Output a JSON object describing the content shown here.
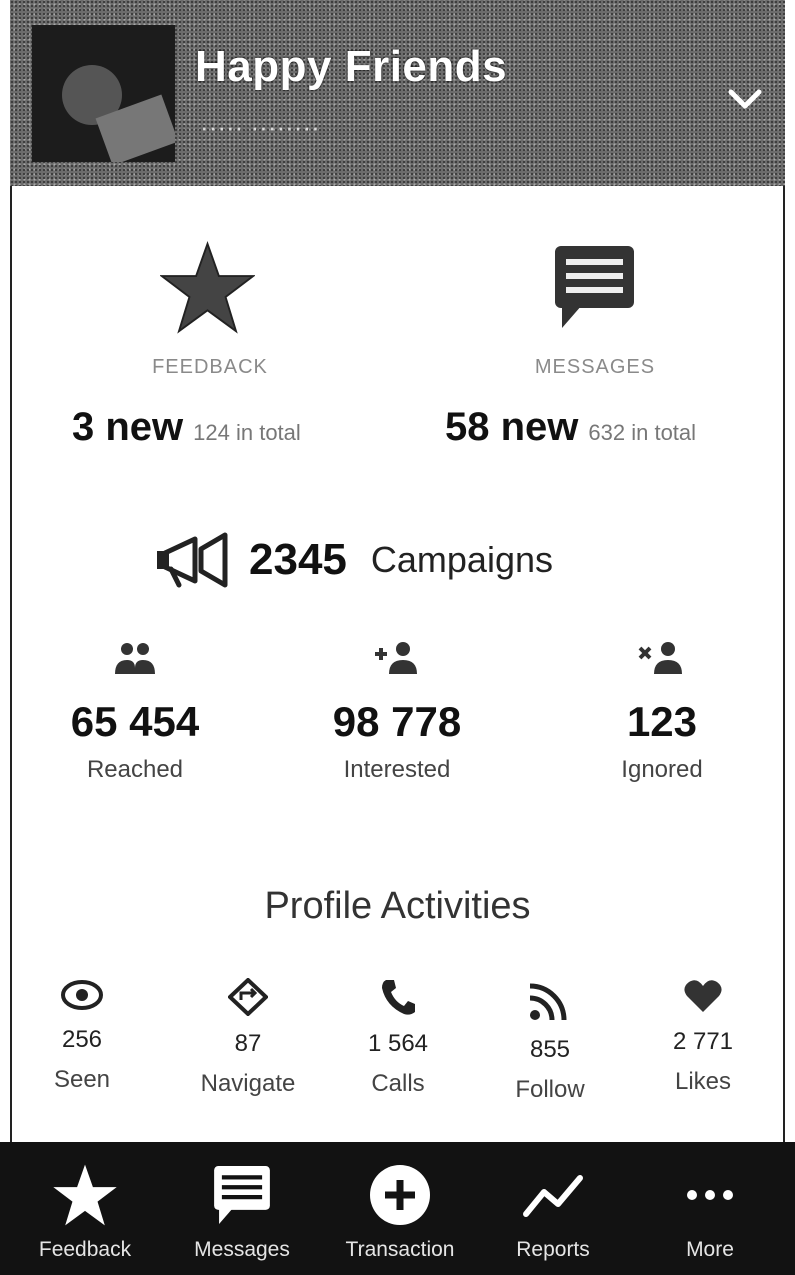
{
  "header": {
    "title": "Happy Friends",
    "subtitle": "·····  ········"
  },
  "stats": {
    "feedback": {
      "label": "FEEDBACK",
      "new": "3 new",
      "total": "124 in total"
    },
    "messages": {
      "label": "MESSAGES",
      "new": "58 new",
      "total": "632 in total"
    }
  },
  "campaigns": {
    "count": "2345",
    "label": "Campaigns"
  },
  "metrics": [
    {
      "value": "65 454",
      "label": "Reached",
      "icon": "people-icon"
    },
    {
      "value": "98 778",
      "label": "Interested",
      "icon": "add-user-icon"
    },
    {
      "value": "123",
      "label": "Ignored",
      "icon": "remove-user-icon"
    }
  ],
  "activities": {
    "title": "Profile Activities",
    "items": [
      {
        "value": "256",
        "label": "Seen",
        "icon": "eye-icon"
      },
      {
        "value": "87",
        "label": "Navigate",
        "icon": "navigate-icon"
      },
      {
        "value": "1 564",
        "label": "Calls",
        "icon": "phone-icon"
      },
      {
        "value": "855",
        "label": "Follow",
        "icon": "rss-icon"
      },
      {
        "value": "2 771",
        "label": "Likes",
        "icon": "heart-icon"
      }
    ]
  },
  "tabbar": [
    {
      "label": "Feedback",
      "icon": "star-icon"
    },
    {
      "label": "Messages",
      "icon": "message-icon"
    },
    {
      "label": "Transaction",
      "icon": "plus-circle-icon"
    },
    {
      "label": "Reports",
      "icon": "chart-line-icon"
    },
    {
      "label": "More",
      "icon": "more-icon"
    }
  ]
}
